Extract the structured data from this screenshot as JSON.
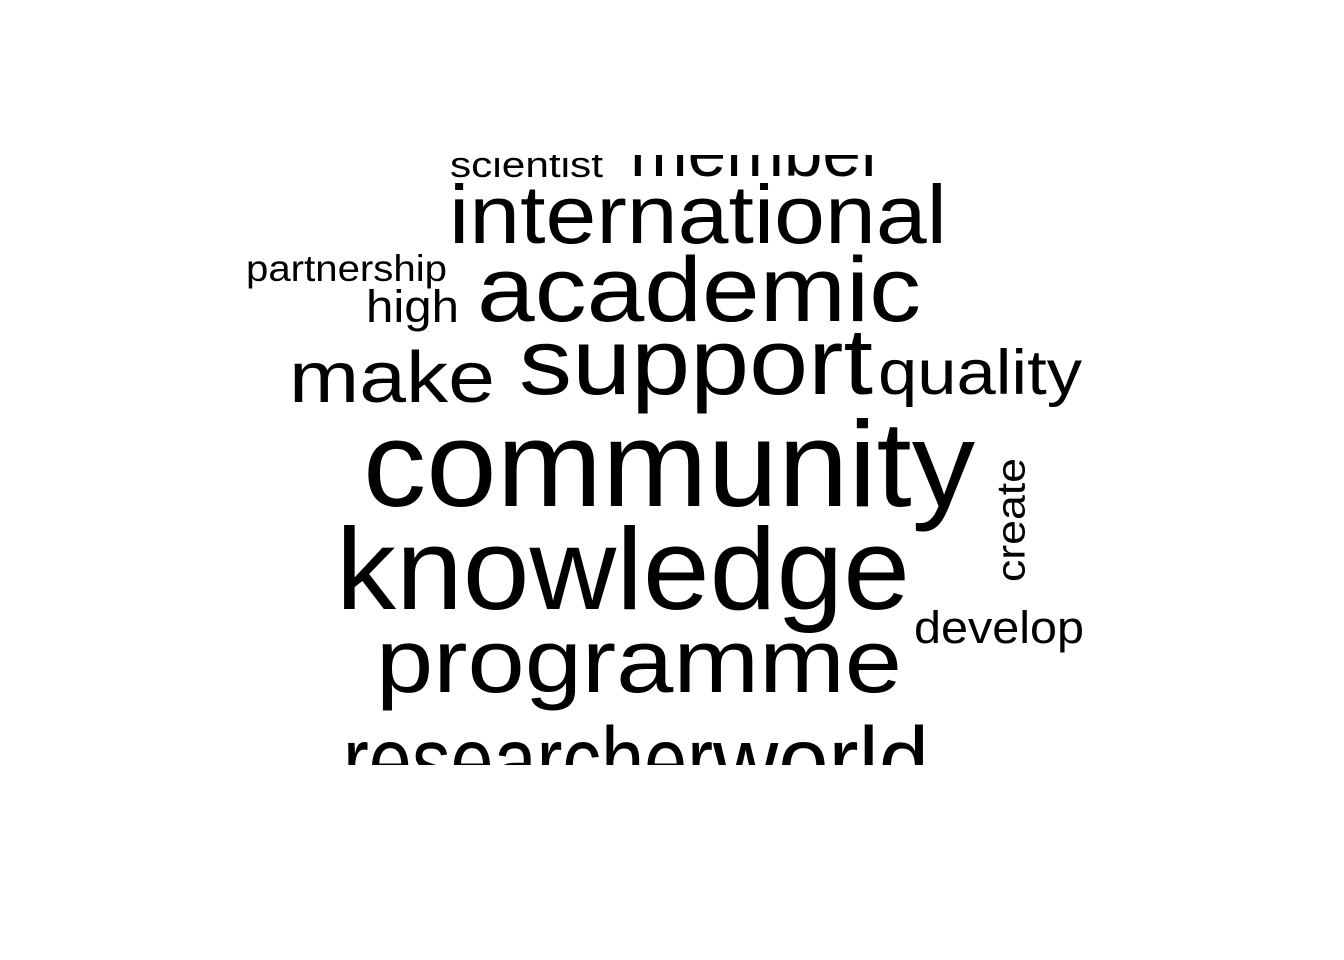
{
  "word_cloud": {
    "text_color": "#000000",
    "background_color": "#ffffff",
    "words": [
      {
        "text": "community"
      },
      {
        "text": "knowledge"
      },
      {
        "text": "programme"
      },
      {
        "text": "support"
      },
      {
        "text": "academic"
      },
      {
        "text": "international"
      },
      {
        "text": "make"
      },
      {
        "text": "quality"
      },
      {
        "text": "member"
      },
      {
        "text": "researcher"
      },
      {
        "text": "world"
      },
      {
        "text": "high"
      },
      {
        "text": "develop"
      },
      {
        "text": "create"
      },
      {
        "text": "partnership"
      },
      {
        "text": "scientist"
      }
    ]
  }
}
